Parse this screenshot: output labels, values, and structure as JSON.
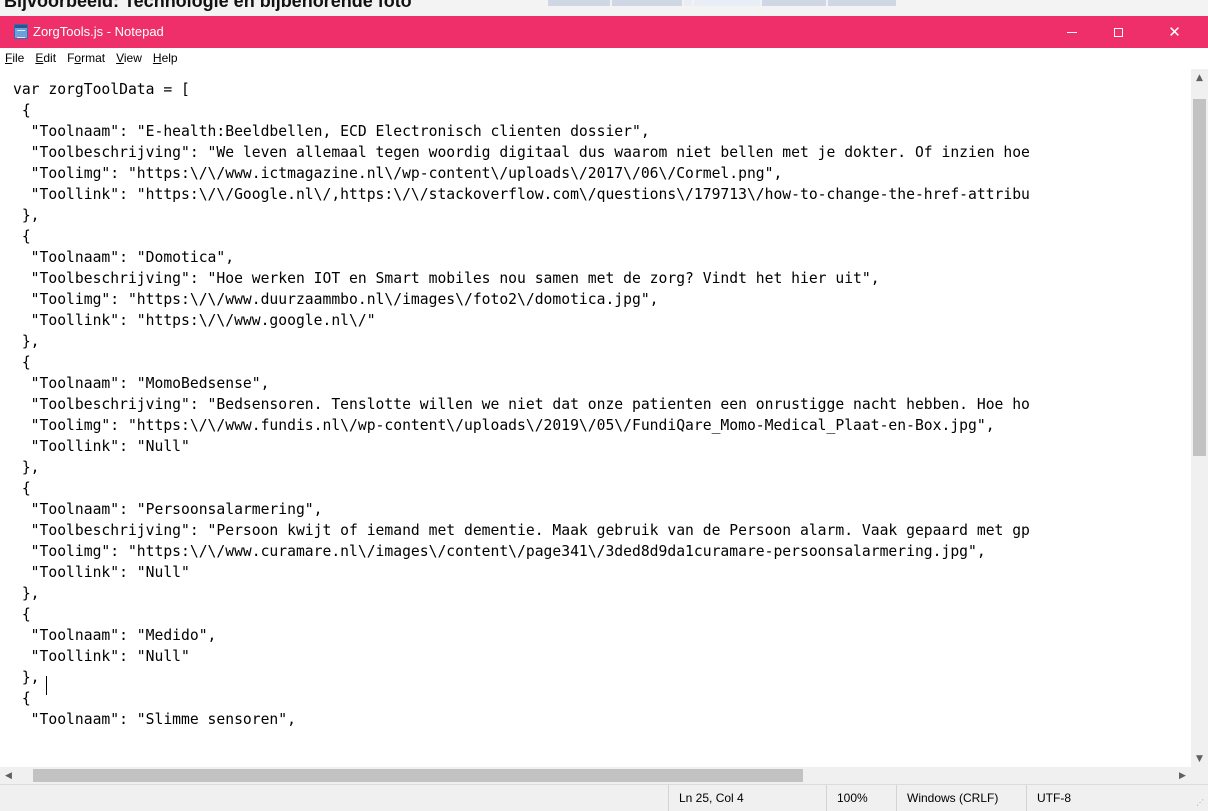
{
  "background_app": {
    "partial_text": "Bijvoorbeeld: Technologie en bijbehorende foto"
  },
  "window": {
    "title": "ZorgTools.js - Notepad",
    "accent_color": "#ef2f6a",
    "controls": {
      "minimize_icon": "minimize-icon",
      "maximize_icon": "maximize-icon",
      "close_icon": "close-icon"
    }
  },
  "menu": {
    "items": [
      {
        "accel": "F",
        "rest": "ile"
      },
      {
        "accel": "E",
        "rest": "dit"
      },
      {
        "pre": "F",
        "accel": "o",
        "rest": "rmat"
      },
      {
        "accel": "V",
        "rest": "iew"
      },
      {
        "accel": "H",
        "rest": "elp"
      }
    ]
  },
  "editor": {
    "lines": [
      "var zorgToolData = [",
      " {",
      "  \"Toolnaam\": \"E-health:Beeldbellen, ECD Electronisch clienten dossier\",",
      "  \"Toolbeschrijving\": \"We leven allemaal tegen woordig digitaal dus waarom niet bellen met je dokter. Of inzien hoe",
      "  \"Toolimg\": \"https:\\/\\/www.ictmagazine.nl\\/wp-content\\/uploads\\/2017\\/06\\/Cormel.png\",",
      "  \"Toollink\": \"https:\\/\\/Google.nl\\/,https:\\/\\/stackoverflow.com\\/questions\\/179713\\/how-to-change-the-href-attribu",
      " },",
      " {",
      "  \"Toolnaam\": \"Domotica\",",
      "  \"Toolbeschrijving\": \"Hoe werken IOT en Smart mobiles nou samen met de zorg? Vindt het hier uit\",",
      "  \"Toolimg\": \"https:\\/\\/www.duurzaammbo.nl\\/images\\/foto2\\/domotica.jpg\",",
      "  \"Toollink\": \"https:\\/\\/www.google.nl\\/\"",
      " },",
      " {",
      "  \"Toolnaam\": \"MomoBedsense\",",
      "  \"Toolbeschrijving\": \"Bedsensoren. Tenslotte willen we niet dat onze patienten een onrustigge nacht hebben. Hoe ho",
      "  \"Toolimg\": \"https:\\/\\/www.fundis.nl\\/wp-content\\/uploads\\/2019\\/05\\/FundiQare_Momo-Medical_Plaat-en-Box.jpg\",",
      "  \"Toollink\": \"Null\"",
      " },",
      " {",
      "  \"Toolnaam\": \"Persoonsalarmering\",",
      "  \"Toolbeschrijving\": \"Persoon kwijt of iemand met dementie. Maak gebruik van de Persoon alarm. Vaak gepaard met gp",
      "  \"Toolimg\": \"https:\\/\\/www.curamare.nl\\/images\\/content\\/page341\\/3ded8d9da1curamare-persoonsalarmering.jpg\",",
      "  \"Toollink\": \"Null\"",
      " },",
      " {",
      "  \"Toolnaam\": \"Medido\",",
      "  \"Toollink\": \"Null\"",
      " },",
      " {",
      "  \"Toolnaam\": \"Slimme sensoren\","
    ]
  },
  "scrollbars": {
    "up_icon": "scroll-up-icon",
    "down_icon": "scroll-down-icon",
    "left_icon": "scroll-left-icon",
    "right_icon": "scroll-right-icon"
  },
  "statusbar": {
    "position": "Ln 25, Col 4",
    "zoom": "100%",
    "line_ending": "Windows (CRLF)",
    "encoding": "UTF-8"
  }
}
